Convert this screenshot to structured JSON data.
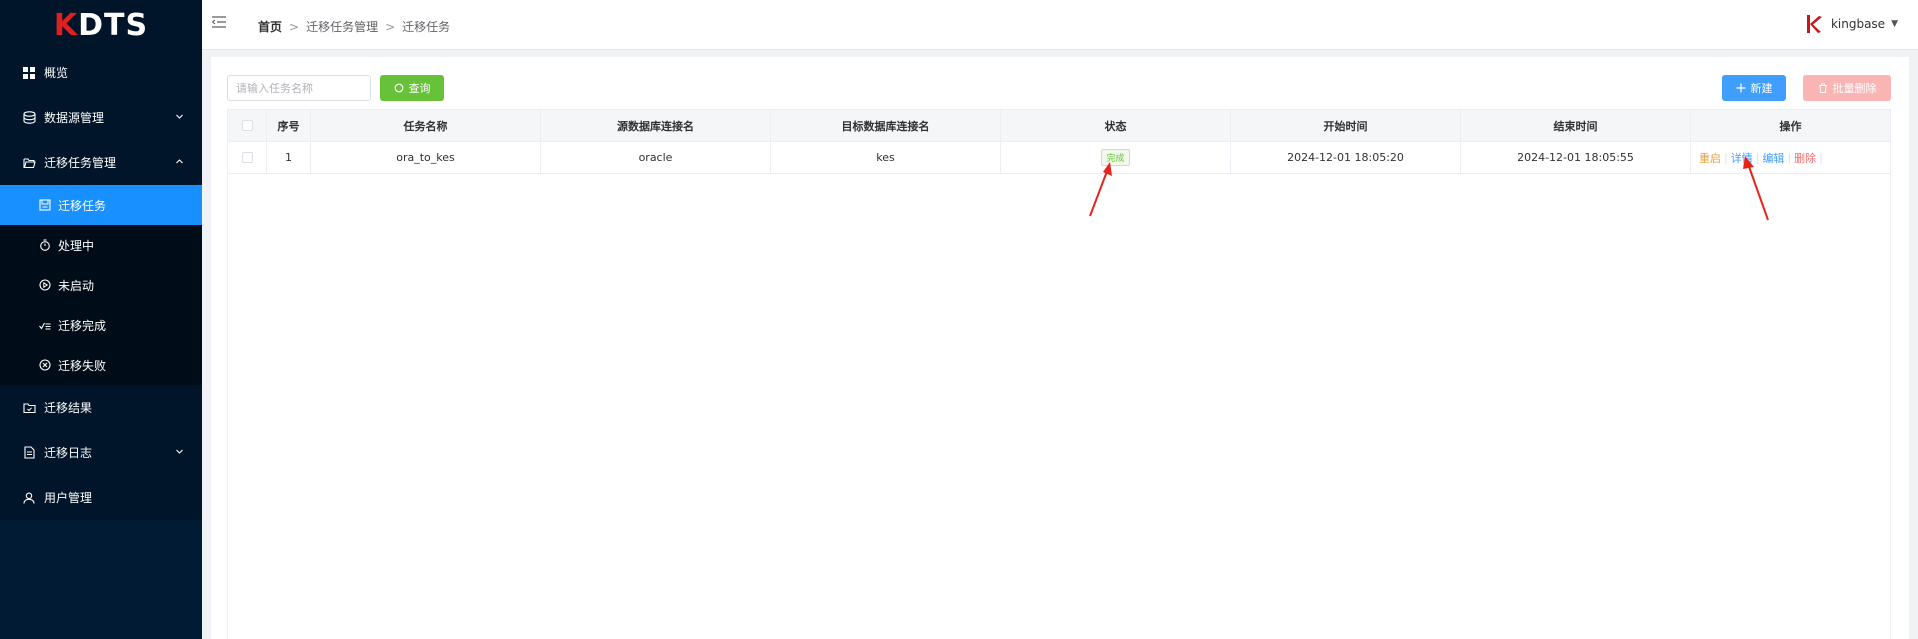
{
  "app": {
    "logo_k": "K",
    "logo_rest": "DTS"
  },
  "sidebar": {
    "items": [
      {
        "label": "概览",
        "icon": "grid-icon"
      },
      {
        "label": "数据源管理",
        "icon": "database-icon",
        "arrow": "chevron-down"
      },
      {
        "label": "迁移任务管理",
        "icon": "folder-open-icon",
        "arrow": "chevron-up"
      },
      {
        "label": "迁移结果",
        "icon": "folder-check-icon"
      },
      {
        "label": "迁移日志",
        "icon": "document-icon",
        "arrow": "chevron-down"
      },
      {
        "label": "用户管理",
        "icon": "user-icon"
      }
    ],
    "subitems": [
      {
        "label": "迁移任务",
        "icon": "save-icon",
        "active": true
      },
      {
        "label": "处理中",
        "icon": "stopwatch-icon"
      },
      {
        "label": "未启动",
        "icon": "play-circle-icon"
      },
      {
        "label": "迁移完成",
        "icon": "list-check-icon"
      },
      {
        "label": "迁移失败",
        "icon": "close-circle-icon"
      }
    ]
  },
  "header": {
    "breadcrumb": [
      "首页",
      "迁移任务管理",
      "迁移任务"
    ],
    "username": "kingbase"
  },
  "toolbar": {
    "search_placeholder": "请输入任务名称",
    "query_label": "查询",
    "new_label": "新建",
    "batch_delete_label": "批量删除"
  },
  "table": {
    "headers": [
      "序号",
      "任务名称",
      "源数据库连接名",
      "目标数据库连接名",
      "状态",
      "开始时间",
      "结束时间",
      "操作"
    ],
    "rows": [
      {
        "index": "1",
        "name": "ora_to_kes",
        "source": "oracle",
        "target": "kes",
        "status": "完成",
        "start": "2024-12-01 18:05:20",
        "end": "2024-12-01 18:05:55",
        "ops": [
          "重启",
          "详情",
          "编辑",
          "删除"
        ]
      }
    ]
  },
  "colors": {
    "sidebar_bg": "#001529",
    "active": "#1890ff",
    "query_button": "#67c23a",
    "new_button": "#409eff",
    "delete_button_disabled": "#f9b4b4",
    "annotation_arrow": "#e8231b"
  }
}
